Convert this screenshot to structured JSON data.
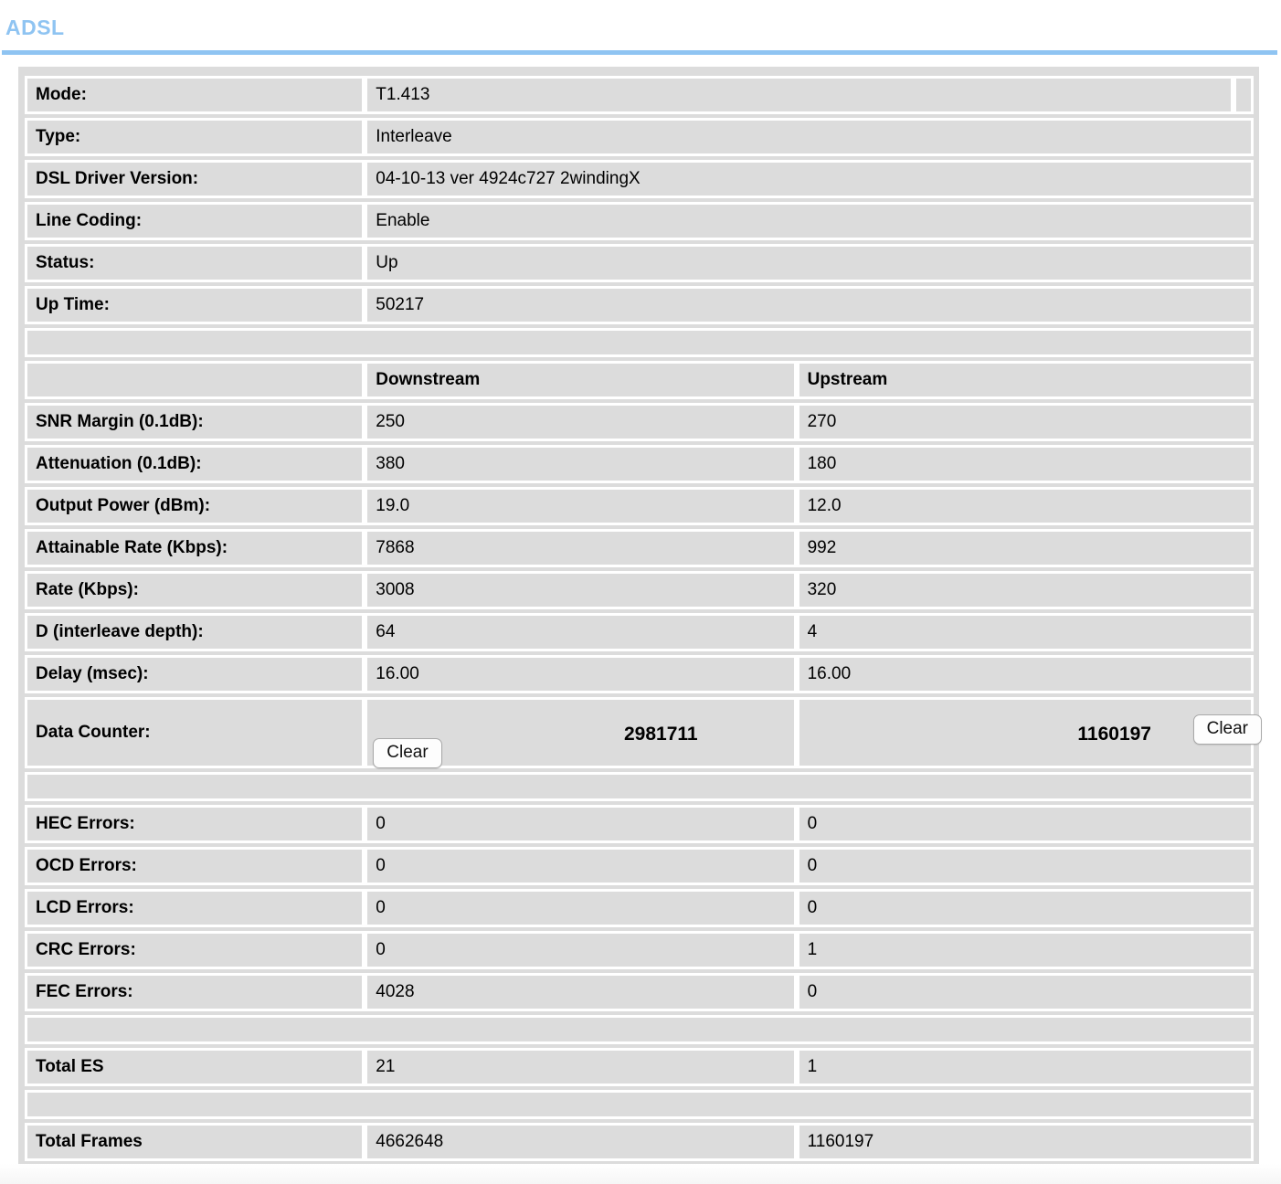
{
  "header": {
    "title": "ADSL"
  },
  "buttons": {
    "clear_label": "Clear"
  },
  "table": {
    "columns": {
      "blank": "",
      "downstream": "Downstream",
      "upstream": "Upstream"
    },
    "general": [
      {
        "label": "Mode:",
        "value": "T1.413"
      },
      {
        "label": "Type:",
        "value": "Interleave"
      },
      {
        "label": "DSL Driver Version:",
        "value": "04-10-13 ver 4924c727 2windingX"
      },
      {
        "label": "Line Coding:",
        "value": "Enable"
      },
      {
        "label": "Status:",
        "value": "Up"
      },
      {
        "label": "Up Time:",
        "value": "50217"
      }
    ],
    "line_stats": [
      {
        "label": "SNR Margin (0.1dB):",
        "downstream": "250",
        "upstream": "270"
      },
      {
        "label": "Attenuation (0.1dB):",
        "downstream": "380",
        "upstream": "180"
      },
      {
        "label": "Output Power (dBm):",
        "downstream": "19.0",
        "upstream": "12.0"
      },
      {
        "label": "Attainable Rate (Kbps):",
        "downstream": "7868",
        "upstream": "992"
      },
      {
        "label": "Rate (Kbps):",
        "downstream": "3008",
        "upstream": "320"
      },
      {
        "label": "D (interleave depth):",
        "downstream": "64",
        "upstream": "4"
      },
      {
        "label": "Delay (msec):",
        "downstream": "16.00",
        "upstream": "16.00"
      }
    ],
    "data_counter": {
      "label": "Data Counter:",
      "downstream": "2981711",
      "upstream": "1160197"
    },
    "errors": [
      {
        "label": "HEC Errors:",
        "downstream": "0",
        "upstream": "0"
      },
      {
        "label": "OCD Errors:",
        "downstream": "0",
        "upstream": "0"
      },
      {
        "label": "LCD Errors:",
        "downstream": "0",
        "upstream": "0"
      },
      {
        "label": "CRC Errors:",
        "downstream": "0",
        "upstream": "1"
      },
      {
        "label": "FEC Errors:",
        "downstream": "4028",
        "upstream": "0"
      }
    ],
    "total_es": {
      "label": "Total ES",
      "downstream": "21",
      "upstream": "1"
    },
    "total_frames": {
      "label": "Total Frames",
      "downstream": "4662648",
      "upstream": "1160197"
    }
  }
}
